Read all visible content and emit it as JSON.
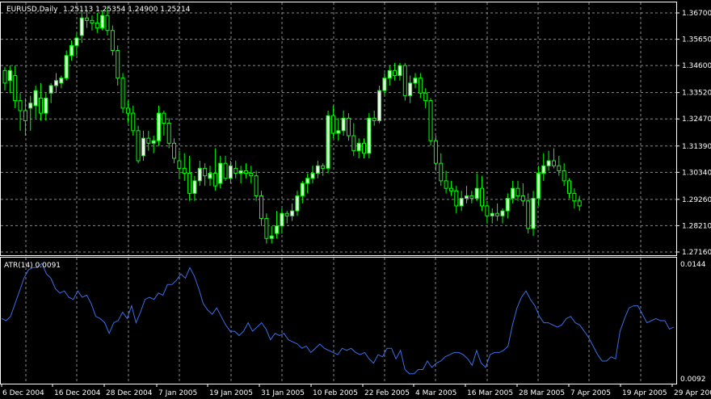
{
  "header": {
    "symbol_label": "EURUSD,Daily",
    "ohlc_label": "1.25113 1.25354 1.24900 1.25214"
  },
  "atr": {
    "label": "ATR(14) 0.0091",
    "axis_top": "0.0144",
    "axis_bottom": "0.0092"
  },
  "price_axis": [
    "1.36700",
    "1.35650",
    "1.34600",
    "1.33520",
    "1.32470",
    "1.31390",
    "1.30340",
    "1.29260",
    "1.28210",
    "1.27160"
  ],
  "date_axis": [
    "6 Dec 2004",
    "16 Dec 2004",
    "28 Dec 2004",
    "7 Jan 2005",
    "19 Jan 2005",
    "31 Jan 2005",
    "10 Feb 2005",
    "22 Feb 2005",
    "4 Mar 2005",
    "16 Mar 2005",
    "28 Mar 2005",
    "7 Apr 2005",
    "19 Apr 2005",
    "29 Apr 200"
  ],
  "colors": {
    "background": "#000000",
    "grid": "#8a8a8a",
    "bull_candle": "#e6ffe6",
    "bear_candle": "#000000",
    "wick": "#00ff00",
    "atr_line": "#3a6fe6",
    "text": "#ffffff"
  },
  "chart_data": {
    "type": "candlestick",
    "ylim": [
      1.2716,
      1.37
    ],
    "candles": [
      {
        "o": 1.344,
        "h": 1.3455,
        "l": 1.336,
        "c": 1.339
      },
      {
        "o": 1.34,
        "h": 1.346,
        "l": 1.335,
        "c": 1.344
      },
      {
        "o": 1.342,
        "h": 1.346,
        "l": 1.329,
        "c": 1.332
      },
      {
        "o": 1.332,
        "h": 1.335,
        "l": 1.32,
        "c": 1.328
      },
      {
        "o": 1.328,
        "h": 1.333,
        "l": 1.318,
        "c": 1.324
      },
      {
        "o": 1.329,
        "h": 1.334,
        "l": 1.32,
        "c": 1.331
      },
      {
        "o": 1.33,
        "h": 1.338,
        "l": 1.325,
        "c": 1.336
      },
      {
        "o": 1.333,
        "h": 1.339,
        "l": 1.324,
        "c": 1.327
      },
      {
        "o": 1.327,
        "h": 1.335,
        "l": 1.324,
        "c": 1.333
      },
      {
        "o": 1.335,
        "h": 1.339,
        "l": 1.331,
        "c": 1.338
      },
      {
        "o": 1.338,
        "h": 1.343,
        "l": 1.335,
        "c": 1.34
      },
      {
        "o": 1.339,
        "h": 1.342,
        "l": 1.337,
        "c": 1.341
      },
      {
        "o": 1.341,
        "h": 1.352,
        "l": 1.34,
        "c": 1.35
      },
      {
        "o": 1.35,
        "h": 1.356,
        "l": 1.348,
        "c": 1.354
      },
      {
        "o": 1.354,
        "h": 1.359,
        "l": 1.35,
        "c": 1.357
      },
      {
        "o": 1.358,
        "h": 1.368,
        "l": 1.355,
        "c": 1.365
      },
      {
        "o": 1.365,
        "h": 1.368,
        "l": 1.361,
        "c": 1.364
      },
      {
        "o": 1.364,
        "h": 1.366,
        "l": 1.36,
        "c": 1.363
      },
      {
        "o": 1.363,
        "h": 1.367,
        "l": 1.359,
        "c": 1.361
      },
      {
        "o": 1.361,
        "h": 1.368,
        "l": 1.36,
        "c": 1.366
      },
      {
        "o": 1.366,
        "h": 1.369,
        "l": 1.358,
        "c": 1.36
      },
      {
        "o": 1.36,
        "h": 1.362,
        "l": 1.35,
        "c": 1.352
      },
      {
        "o": 1.352,
        "h": 1.354,
        "l": 1.338,
        "c": 1.341
      },
      {
        "o": 1.341,
        "h": 1.343,
        "l": 1.327,
        "c": 1.329
      },
      {
        "o": 1.329,
        "h": 1.332,
        "l": 1.323,
        "c": 1.327
      },
      {
        "o": 1.327,
        "h": 1.33,
        "l": 1.318,
        "c": 1.32
      },
      {
        "o": 1.32,
        "h": 1.322,
        "l": 1.307,
        "c": 1.308
      },
      {
        "o": 1.31,
        "h": 1.32,
        "l": 1.308,
        "c": 1.317
      },
      {
        "o": 1.317,
        "h": 1.32,
        "l": 1.312,
        "c": 1.315
      },
      {
        "o": 1.315,
        "h": 1.318,
        "l": 1.311,
        "c": 1.316
      },
      {
        "o": 1.316,
        "h": 1.33,
        "l": 1.314,
        "c": 1.327
      },
      {
        "o": 1.327,
        "h": 1.328,
        "l": 1.318,
        "c": 1.323
      },
      {
        "o": 1.323,
        "h": 1.325,
        "l": 1.313,
        "c": 1.315
      },
      {
        "o": 1.315,
        "h": 1.317,
        "l": 1.307,
        "c": 1.309
      },
      {
        "o": 1.308,
        "h": 1.312,
        "l": 1.301,
        "c": 1.305
      },
      {
        "o": 1.305,
        "h": 1.311,
        "l": 1.3,
        "c": 1.303
      },
      {
        "o": 1.303,
        "h": 1.31,
        "l": 1.292,
        "c": 1.295
      },
      {
        "o": 1.295,
        "h": 1.302,
        "l": 1.292,
        "c": 1.3
      },
      {
        "o": 1.3,
        "h": 1.308,
        "l": 1.298,
        "c": 1.305
      },
      {
        "o": 1.305,
        "h": 1.307,
        "l": 1.298,
        "c": 1.302
      },
      {
        "o": 1.301,
        "h": 1.306,
        "l": 1.298,
        "c": 1.303
      },
      {
        "o": 1.303,
        "h": 1.313,
        "l": 1.296,
        "c": 1.298
      },
      {
        "o": 1.299,
        "h": 1.31,
        "l": 1.297,
        "c": 1.307
      },
      {
        "o": 1.307,
        "h": 1.31,
        "l": 1.3,
        "c": 1.301
      },
      {
        "o": 1.301,
        "h": 1.308,
        "l": 1.299,
        "c": 1.306
      },
      {
        "o": 1.305,
        "h": 1.308,
        "l": 1.301,
        "c": 1.303
      },
      {
        "o": 1.303,
        "h": 1.306,
        "l": 1.299,
        "c": 1.304
      },
      {
        "o": 1.304,
        "h": 1.307,
        "l": 1.301,
        "c": 1.303
      },
      {
        "o": 1.303,
        "h": 1.306,
        "l": 1.299,
        "c": 1.302
      },
      {
        "o": 1.302,
        "h": 1.304,
        "l": 1.292,
        "c": 1.294
      },
      {
        "o": 1.294,
        "h": 1.296,
        "l": 1.282,
        "c": 1.285
      },
      {
        "o": 1.285,
        "h": 1.287,
        "l": 1.275,
        "c": 1.277
      },
      {
        "o": 1.277,
        "h": 1.282,
        "l": 1.275,
        "c": 1.278
      },
      {
        "o": 1.279,
        "h": 1.288,
        "l": 1.277,
        "c": 1.282
      },
      {
        "o": 1.282,
        "h": 1.289,
        "l": 1.279,
        "c": 1.287
      },
      {
        "o": 1.287,
        "h": 1.288,
        "l": 1.283,
        "c": 1.286
      },
      {
        "o": 1.286,
        "h": 1.291,
        "l": 1.284,
        "c": 1.288
      },
      {
        "o": 1.288,
        "h": 1.296,
        "l": 1.286,
        "c": 1.294
      },
      {
        "o": 1.294,
        "h": 1.3,
        "l": 1.291,
        "c": 1.299
      },
      {
        "o": 1.299,
        "h": 1.303,
        "l": 1.295,
        "c": 1.301
      },
      {
        "o": 1.301,
        "h": 1.306,
        "l": 1.299,
        "c": 1.303
      },
      {
        "o": 1.303,
        "h": 1.308,
        "l": 1.301,
        "c": 1.306
      },
      {
        "o": 1.306,
        "h": 1.307,
        "l": 1.302,
        "c": 1.305
      },
      {
        "o": 1.305,
        "h": 1.328,
        "l": 1.303,
        "c": 1.326
      },
      {
        "o": 1.326,
        "h": 1.33,
        "l": 1.317,
        "c": 1.319
      },
      {
        "o": 1.319,
        "h": 1.325,
        "l": 1.316,
        "c": 1.32
      },
      {
        "o": 1.32,
        "h": 1.328,
        "l": 1.318,
        "c": 1.325
      },
      {
        "o": 1.325,
        "h": 1.327,
        "l": 1.316,
        "c": 1.318
      },
      {
        "o": 1.318,
        "h": 1.323,
        "l": 1.31,
        "c": 1.312
      },
      {
        "o": 1.312,
        "h": 1.317,
        "l": 1.309,
        "c": 1.315
      },
      {
        "o": 1.315,
        "h": 1.317,
        "l": 1.309,
        "c": 1.311
      },
      {
        "o": 1.311,
        "h": 1.327,
        "l": 1.309,
        "c": 1.325
      },
      {
        "o": 1.325,
        "h": 1.328,
        "l": 1.322,
        "c": 1.324
      },
      {
        "o": 1.324,
        "h": 1.338,
        "l": 1.323,
        "c": 1.336
      },
      {
        "o": 1.336,
        "h": 1.343,
        "l": 1.334,
        "c": 1.341
      },
      {
        "o": 1.341,
        "h": 1.346,
        "l": 1.338,
        "c": 1.344
      },
      {
        "o": 1.344,
        "h": 1.347,
        "l": 1.34,
        "c": 1.342
      },
      {
        "o": 1.342,
        "h": 1.347,
        "l": 1.34,
        "c": 1.346
      },
      {
        "o": 1.346,
        "h": 1.347,
        "l": 1.332,
        "c": 1.334
      },
      {
        "o": 1.334,
        "h": 1.342,
        "l": 1.331,
        "c": 1.339
      },
      {
        "o": 1.339,
        "h": 1.343,
        "l": 1.337,
        "c": 1.341
      },
      {
        "o": 1.341,
        "h": 1.343,
        "l": 1.333,
        "c": 1.335
      },
      {
        "o": 1.335,
        "h": 1.337,
        "l": 1.329,
        "c": 1.332
      },
      {
        "o": 1.332,
        "h": 1.333,
        "l": 1.314,
        "c": 1.316
      },
      {
        "o": 1.316,
        "h": 1.318,
        "l": 1.304,
        "c": 1.307
      },
      {
        "o": 1.307,
        "h": 1.311,
        "l": 1.298,
        "c": 1.3
      },
      {
        "o": 1.3,
        "h": 1.304,
        "l": 1.295,
        "c": 1.297
      },
      {
        "o": 1.297,
        "h": 1.3,
        "l": 1.294,
        "c": 1.296
      },
      {
        "o": 1.296,
        "h": 1.298,
        "l": 1.287,
        "c": 1.29
      },
      {
        "o": 1.29,
        "h": 1.296,
        "l": 1.288,
        "c": 1.293
      },
      {
        "o": 1.293,
        "h": 1.298,
        "l": 1.291,
        "c": 1.294
      },
      {
        "o": 1.294,
        "h": 1.296,
        "l": 1.291,
        "c": 1.293
      },
      {
        "o": 1.293,
        "h": 1.303,
        "l": 1.292,
        "c": 1.297
      },
      {
        "o": 1.297,
        "h": 1.302,
        "l": 1.288,
        "c": 1.29
      },
      {
        "o": 1.29,
        "h": 1.292,
        "l": 1.283,
        "c": 1.286
      },
      {
        "o": 1.286,
        "h": 1.289,
        "l": 1.283,
        "c": 1.287
      },
      {
        "o": 1.287,
        "h": 1.291,
        "l": 1.284,
        "c": 1.286
      },
      {
        "o": 1.286,
        "h": 1.289,
        "l": 1.283,
        "c": 1.288
      },
      {
        "o": 1.288,
        "h": 1.295,
        "l": 1.285,
        "c": 1.293
      },
      {
        "o": 1.293,
        "h": 1.3,
        "l": 1.291,
        "c": 1.297
      },
      {
        "o": 1.297,
        "h": 1.3,
        "l": 1.292,
        "c": 1.294
      },
      {
        "o": 1.294,
        "h": 1.299,
        "l": 1.29,
        "c": 1.292
      },
      {
        "o": 1.292,
        "h": 1.295,
        "l": 1.279,
        "c": 1.281
      },
      {
        "o": 1.281,
        "h": 1.296,
        "l": 1.278,
        "c": 1.293
      },
      {
        "o": 1.293,
        "h": 1.306,
        "l": 1.29,
        "c": 1.303
      },
      {
        "o": 1.303,
        "h": 1.311,
        "l": 1.3,
        "c": 1.306
      },
      {
        "o": 1.306,
        "h": 1.312,
        "l": 1.304,
        "c": 1.308
      },
      {
        "o": 1.308,
        "h": 1.313,
        "l": 1.305,
        "c": 1.306
      },
      {
        "o": 1.306,
        "h": 1.31,
        "l": 1.302,
        "c": 1.304
      },
      {
        "o": 1.304,
        "h": 1.307,
        "l": 1.298,
        "c": 1.3
      },
      {
        "o": 1.3,
        "h": 1.301,
        "l": 1.293,
        "c": 1.295
      },
      {
        "o": 1.295,
        "h": 1.297,
        "l": 1.289,
        "c": 1.292
      },
      {
        "o": 1.292,
        "h": 1.294,
        "l": 1.288,
        "c": 1.29
      }
    ],
    "atr_values": [
      0.012,
      0.0119,
      0.0121,
      0.0127,
      0.0133,
      0.0139,
      0.0143,
      0.0144,
      0.0144,
      0.0146,
      0.0141,
      0.0139,
      0.0134,
      0.0132,
      0.0133,
      0.013,
      0.0129,
      0.0133,
      0.013,
      0.0131,
      0.0127,
      0.0121,
      0.012,
      0.0118,
      0.0113,
      0.0118,
      0.0119,
      0.0123,
      0.012,
      0.0126,
      0.0118,
      0.0123,
      0.0129,
      0.013,
      0.0129,
      0.0132,
      0.0131,
      0.0136,
      0.0136,
      0.0138,
      0.0141,
      0.0139,
      0.0144,
      0.014,
      0.0134,
      0.0127,
      0.0124,
      0.0122,
      0.0125,
      0.0121,
      0.0117,
      0.0114,
      0.0114,
      0.0112,
      0.0114,
      0.0118,
      0.0114,
      0.0116,
      0.0118,
      0.0115,
      0.011,
      0.0113,
      0.0112,
      0.0113,
      0.011,
      0.0109,
      0.0108,
      0.0106,
      0.0107,
      0.0104,
      0.0106,
      0.0108,
      0.0106,
      0.0105,
      0.0104,
      0.0103,
      0.0106,
      0.0105,
      0.0106,
      0.0104,
      0.0103,
      0.0104,
      0.0101,
      0.0099,
      0.0103,
      0.0102,
      0.0106,
      0.0106,
      0.0101,
      0.0105,
      0.0096,
      0.0094,
      0.0094,
      0.0096,
      0.0096,
      0.01,
      0.0097,
      0.0099,
      0.01,
      0.0102,
      0.0103,
      0.0104,
      0.0104,
      0.0103,
      0.0101,
      0.0098,
      0.0105,
      0.0099,
      0.0097,
      0.0103,
      0.0104,
      0.0104,
      0.0105,
      0.0107,
      0.0117,
      0.0125,
      0.013,
      0.0133,
      0.0129,
      0.0126,
      0.0121,
      0.0118,
      0.0118,
      0.0117,
      0.0116,
      0.0117,
      0.012,
      0.0121,
      0.0118,
      0.0117,
      0.0114,
      0.0111,
      0.0107,
      0.0103,
      0.01,
      0.01,
      0.0102,
      0.0101,
      0.0114,
      0.012,
      0.0125,
      0.0126,
      0.0126,
      0.0122,
      0.0118,
      0.0119,
      0.012,
      0.0119,
      0.0119,
      0.0115,
      0.0116
    ]
  }
}
